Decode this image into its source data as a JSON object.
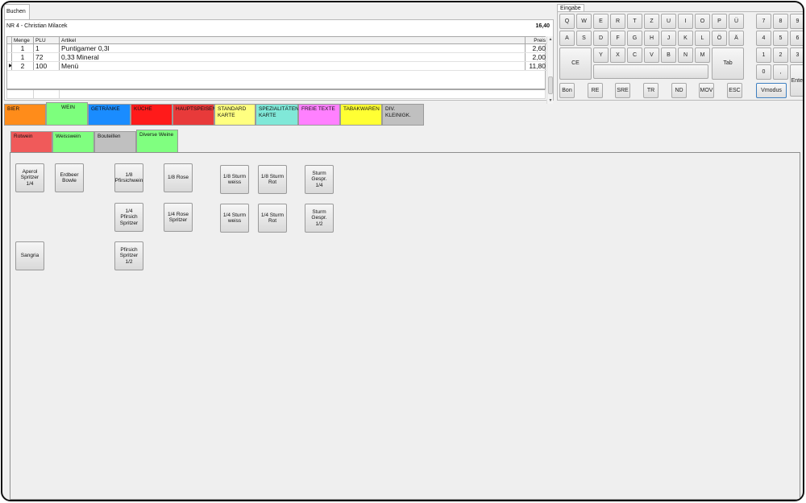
{
  "buchen": {
    "tab_label": "Buchen",
    "order_title": "NR 4 - Christian Milacek",
    "order_total": "16,40",
    "columns": [
      "Menge",
      "PLU",
      "Artikel",
      "Preis"
    ],
    "rows": [
      {
        "menge": "1",
        "plu": "1",
        "artikel": "Puntigamer 0,3l",
        "preis": "2,60"
      },
      {
        "menge": "1",
        "plu": "72",
        "artikel": "0,33 Mineral",
        "preis": "2,00"
      },
      {
        "menge": "2",
        "plu": "100",
        "artikel": "Menü",
        "preis": "11,80"
      }
    ]
  },
  "eingabe": {
    "tab_label": "Eingabe",
    "row1": [
      "Q",
      "W",
      "E",
      "R",
      "T",
      "Z",
      "U",
      "I",
      "O",
      "P",
      "Ü"
    ],
    "row2": [
      "A",
      "S",
      "D",
      "F",
      "G",
      "H",
      "J",
      "K",
      "L",
      "Ö",
      "Ä"
    ],
    "row3": [
      "Y",
      "X",
      "C",
      "V",
      "B",
      "N",
      "M"
    ],
    "ce_label": "CE",
    "tab_key_label": "Tab",
    "function_keys": [
      "Bon",
      "RE",
      "SRE",
      "TR",
      "ND",
      "MOV",
      "ESC"
    ],
    "numpad": [
      "7",
      "8",
      "9",
      "4",
      "5",
      "6",
      "1",
      "2",
      "3",
      "0",
      ","
    ],
    "enter_label": "Enter",
    "vmodus_label": "Vmodus"
  },
  "categories": [
    {
      "label": "BIER",
      "color": "#ff8c1a"
    },
    {
      "label": "WEIN",
      "color": "#7dff7d",
      "active": true
    },
    {
      "label": "GETRÄNKE",
      "color": "#1a8cff"
    },
    {
      "label": "KÜCHE",
      "color": "#ff1a1a"
    },
    {
      "label": "HAUPTSPEISEN",
      "color": "#e83a3a"
    },
    {
      "label": "STANDARD\nKARTE",
      "color": "#ffff80"
    },
    {
      "label": "SPEZIALITÄTEN\nKARTE",
      "color": "#80e8d8"
    },
    {
      "label": "FREIE TEXTE",
      "color": "#ff80ff"
    },
    {
      "label": "TABAKWAREN",
      "color": "#ffff33"
    },
    {
      "label": "DIV.\nKLEINIGK.",
      "color": "#c0c0c0"
    }
  ],
  "subcategories": [
    {
      "label": "Rotwein",
      "color": "#f05a5a"
    },
    {
      "label": "Weisswein",
      "color": "#80ff80"
    },
    {
      "label": "Bouteillen",
      "color": "#c0c0c0"
    },
    {
      "label": "Diverse Weine",
      "color": "#80ff80",
      "active": true
    }
  ],
  "items": [
    {
      "label": "Aperol\nSpritzer\n1/4"
    },
    {
      "label": "Erdbeer\nBowle"
    },
    {
      "label": "1/8\nPfirsichwein"
    },
    {
      "label": "1/8 Rose"
    },
    {
      "label": "1/8 Sturm\nweiss"
    },
    {
      "label": "1/8 Sturm\nRot"
    },
    {
      "label": "Sturm\nGespr.\n1/4"
    },
    {
      "label": "1/4\nPfirsich\nSpritzer"
    },
    {
      "label": "1/4 Rose\nSpritzer"
    },
    {
      "label": "1/4 Sturm\nweiss"
    },
    {
      "label": "1/4 Sturm\nRot"
    },
    {
      "label": "Sturm\nGespr.\n1/2"
    },
    {
      "label": "Sangria"
    },
    {
      "label": "Pfirsich\nSpritzer\n1/2"
    }
  ]
}
